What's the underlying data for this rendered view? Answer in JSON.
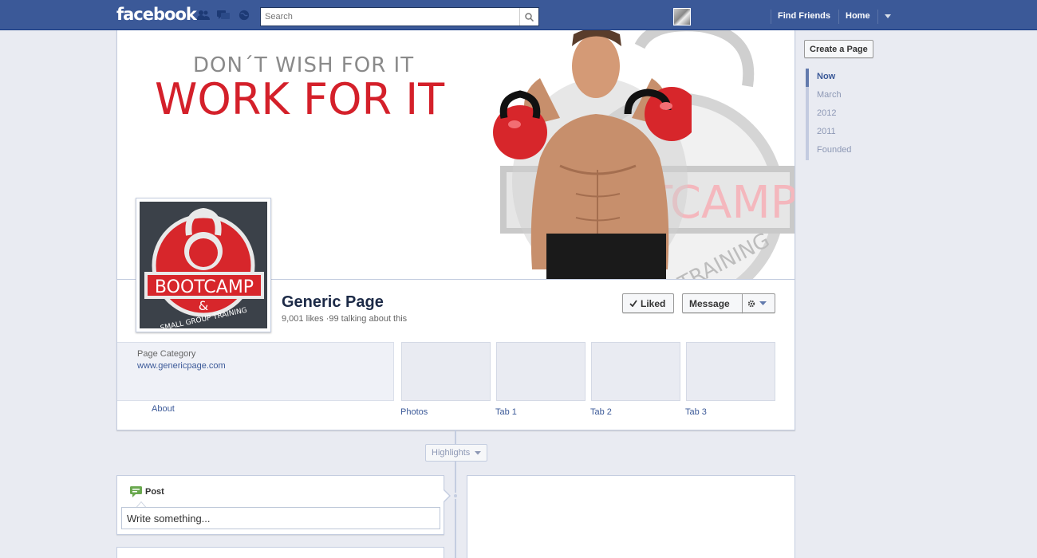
{
  "topbar": {
    "logo": "facebook",
    "search": {
      "placeholder": "Search",
      "value": ""
    },
    "nav": {
      "find_friends": "Find Friends",
      "home": "Home"
    },
    "icons": [
      "friend-requests-icon",
      "messages-icon",
      "notifications-icon",
      "search-icon",
      "account-menu-icon"
    ]
  },
  "cover": {
    "line1": "DON´T WISH FOR IT",
    "line2": "WORK FOR IT",
    "watermark_text": "TCAMP",
    "watermark_sub": "TRAINING"
  },
  "profile": {
    "logo_main": "BOOTCAMP",
    "logo_amp": "&",
    "logo_sub": "SMALL GROUP TRAINING",
    "name": "Generic Page",
    "likes": "9,001 likes",
    "talking": "99 talking about this"
  },
  "actions": {
    "liked": "Liked",
    "message": "Message"
  },
  "info": {
    "category": "Page Category",
    "url": "www.genericpage.com",
    "about": "About"
  },
  "tabs": [
    {
      "label": "Photos"
    },
    {
      "label": "Tab 1"
    },
    {
      "label": "Tab 2"
    },
    {
      "label": "Tab 3"
    }
  ],
  "sidebar": {
    "create_page": "Create a Page",
    "scrubber": [
      {
        "label": "Now",
        "active": true
      },
      {
        "label": "March",
        "active": false
      },
      {
        "label": "2012",
        "active": false
      },
      {
        "label": "2011",
        "active": false
      },
      {
        "label": "Founded",
        "active": false
      }
    ]
  },
  "timeline": {
    "highlights": "Highlights",
    "post_label": "Post",
    "post_placeholder": "Write something..."
  },
  "colors": {
    "brand": "#3b5998",
    "accent_red": "#d4202a"
  }
}
